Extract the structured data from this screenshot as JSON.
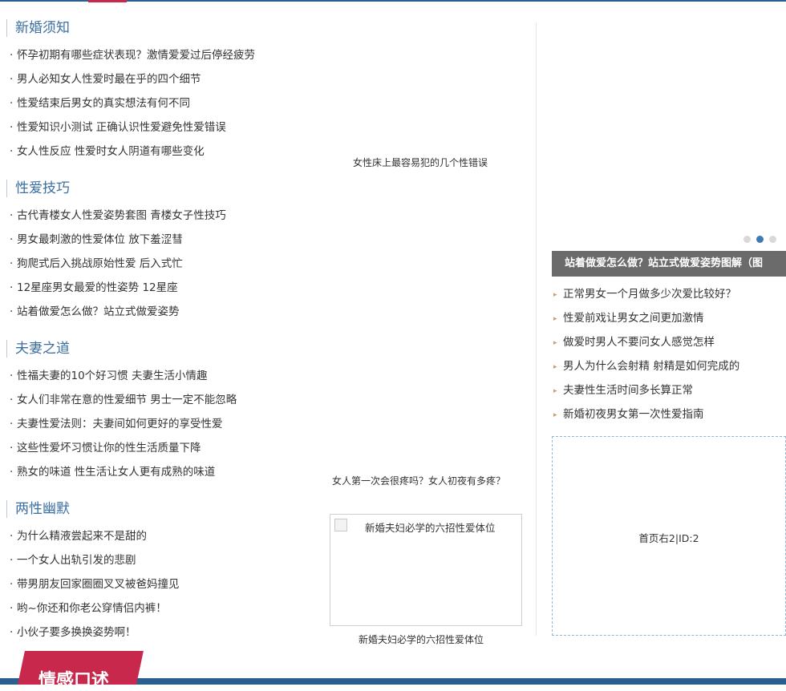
{
  "sections": [
    {
      "title": "新婚须知",
      "items": [
        "怀孕初期有哪些症状表现？激情爱爱过后停经疲劳",
        "男人必知女人性爱时最在乎的四个细节",
        "性爱结束后男女的真实想法有何不同",
        "性爱知识小测试 正确认识性爱避免性爱错误",
        "女人性反应 性爱时女人阴道有哪些变化"
      ]
    },
    {
      "title": "性爱技巧",
      "items": [
        "古代青楼女人性爱姿势套图 青楼女子性技巧",
        "男女最刺激的性爱体位 放下羞涩彗",
        "狗爬式后入挑战原始性爱 后入式忙",
        "12星座男女最爱的性姿势 12星座",
        "站着做爱怎么做？站立式做爱姿势"
      ]
    },
    {
      "title": "夫妻之道",
      "items": [
        "性福夫妻的10个好习惯 夫妻生活小情趣",
        "女人们非常在意的性爱细节 男士一定不能忽略",
        "夫妻性爱法则：夫妻间如何更好的享受性爱",
        "这些性爱坏习惯让你的性生活质量下降",
        "熟女的味道 性生活让女人更有成熟的味道"
      ]
    },
    {
      "title": "两性幽默",
      "items": [
        "为什么精液尝起来不是甜的",
        "一个女人出轨引发的悲剧",
        "带男朋友回家圈圈叉叉被爸妈撞见",
        "哟~你还和你老公穿情侣内裤！",
        "小伙子要多换换姿势啊！"
      ]
    }
  ],
  "middle": {
    "caption_1": "女性床上最容易犯的几个性错误",
    "caption_2": "女人第一次会很疼吗？女人初夜有多疼？",
    "image_alt": "新婚夫妇必学的六招性爱体位",
    "image_caption": "新婚夫妇必学的六招性爱体位"
  },
  "right": {
    "slide_title": "站着做爱怎么做？站立式做爱姿势图解（图",
    "slide_dots": 3,
    "slide_active_index": 1,
    "items": [
      "正常男女一个月做多少次爱比较好？",
      "性爱前戏让男女之间更加激情",
      "做爱时男人不要问女人感觉怎样",
      "男人为什么会射精 射精是如何完成的",
      "夫妻性生活时间多长算正常",
      "新婚初夜男女第一次性爱指南"
    ],
    "ad_label": "首页右2|ID:2"
  },
  "bottom": {
    "tab_label": "情感口述"
  },
  "colors": {
    "accent_blue": "#2b5f8f",
    "title_blue": "#3b6fa2",
    "accent_red": "#c8284b",
    "slide_bar": "#6b6b6b"
  }
}
